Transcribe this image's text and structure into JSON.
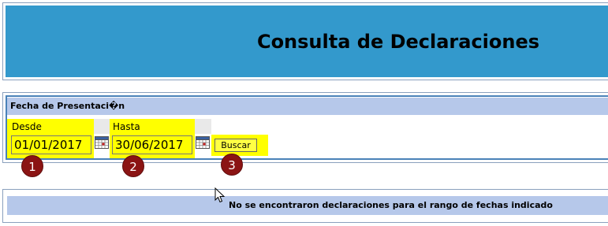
{
  "page": {
    "title": "Consulta de Declaraciones"
  },
  "filter": {
    "section_title": "Fecha de Presentaci�n",
    "from_label": "Desde",
    "from_value": "01/01/2017",
    "to_label": "Hasta",
    "to_value": "30/06/2017",
    "search_label": "Buscar"
  },
  "annotations": {
    "step1": "1",
    "step2": "2",
    "step3": "3"
  },
  "results": {
    "message": "No se encontraron declaraciones para el rango de fechas indicado"
  },
  "icons": {
    "calendar": "calendar-icon",
    "cursor": "mouse-pointer-icon"
  },
  "colors": {
    "header_bg": "#3399cc",
    "section_bar_bg": "#b6c8ea",
    "highlight": "#ffff00",
    "step_marker": "#8b1414"
  }
}
